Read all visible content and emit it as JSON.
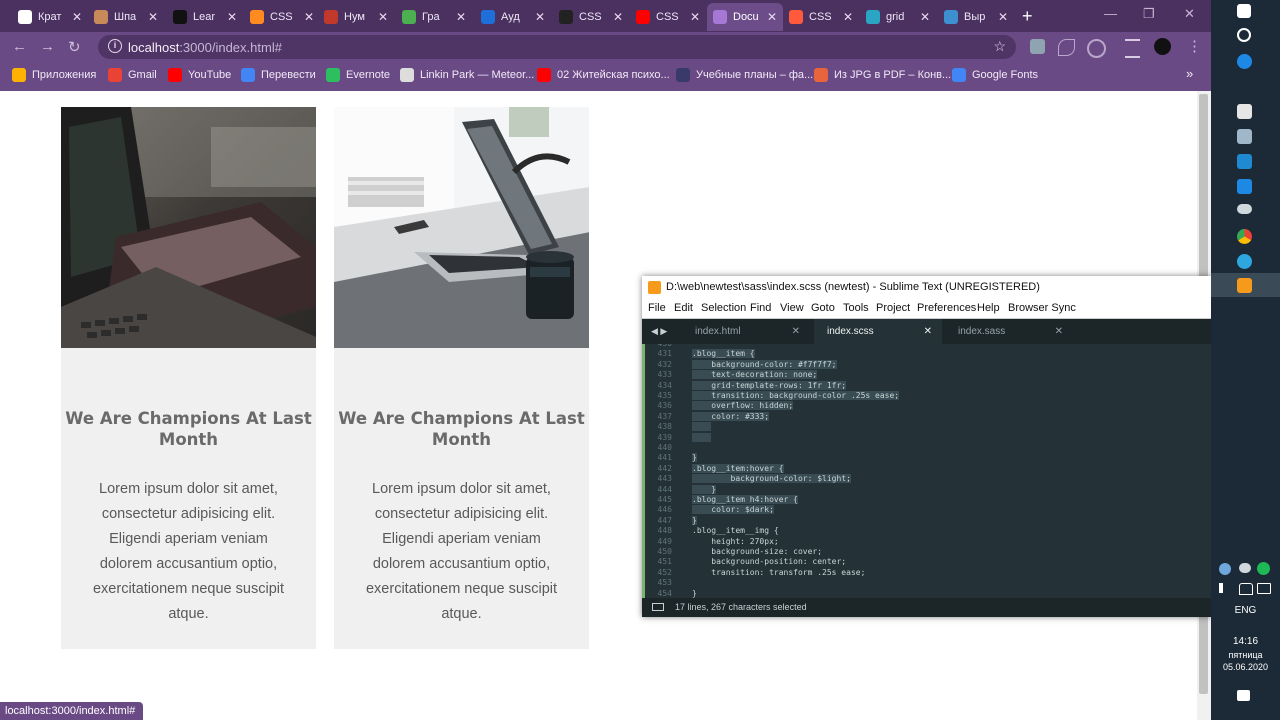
{
  "browser": {
    "tabs": [
      {
        "label": "Крат",
        "favicon_color": "#ffffff"
      },
      {
        "label": "Шпа",
        "favicon_color": "#c98a5a"
      },
      {
        "label": "Lear",
        "favicon_color": "#111111"
      },
      {
        "label": "CSS",
        "favicon_color": "#ff8a1f"
      },
      {
        "label": "Нум",
        "favicon_color": "#c0392b"
      },
      {
        "label": "Гра",
        "favicon_color": "#4caf50"
      },
      {
        "label": "Ауд",
        "favicon_color": "#1e6fd9"
      },
      {
        "label": "CSS",
        "favicon_color": "#222222"
      },
      {
        "label": "CSS",
        "favicon_color": "#ff0000"
      },
      {
        "label": "Docu",
        "favicon_color": "#a678d6",
        "active": true
      },
      {
        "label": "CSS",
        "favicon_color": "#ff5a3c"
      },
      {
        "label": "grid",
        "favicon_color": "#2aa5c4"
      },
      {
        "label": "Выр",
        "favicon_color": "#3d8fd0"
      }
    ],
    "new_tab": "+",
    "window_controls": {
      "minimize": "—",
      "maximize": "❐",
      "close": "✕"
    },
    "nav": {
      "back": "←",
      "forward": "→",
      "reload": "↻"
    },
    "address": {
      "host": "localhost",
      "path": ":3000/index.html#",
      "star": "☆"
    },
    "bookmarks": [
      {
        "label": "Приложения",
        "icon_color": "#ffb300"
      },
      {
        "label": "Gmail",
        "icon_color": "#ea4335"
      },
      {
        "label": "YouTube",
        "icon_color": "#ff0000"
      },
      {
        "label": "Перевести",
        "icon_color": "#4285f4"
      },
      {
        "label": "Evernote",
        "icon_color": "#2dbe60"
      },
      {
        "label": "Linkin Park — Meteor...",
        "icon_color": "#dddddd"
      },
      {
        "label": "02 Житейская психо...",
        "icon_color": "#ff0000"
      },
      {
        "label": "Учебные планы – фа...",
        "icon_color": "#3a3a6a"
      },
      {
        "label": "Из JPG в PDF – Конв...",
        "icon_color": "#e8643c"
      },
      {
        "label": "Google Fonts",
        "icon_color": "#4285f4"
      }
    ],
    "bookmarks_more": "»",
    "status_url": "localhost:3000/index.html#"
  },
  "page": {
    "cards": [
      {
        "title": "We Are Champions At Last Month",
        "text": "Lorem ipsum dolor sit amet, consectetur adipisicing elit. Eligendi aperiam veniam dolorem accusantium optio, exercitationem neque suscipit atque."
      },
      {
        "title": "We Are Champions At Last Month",
        "text": "Lorem ipsum dolor sit amet, consectetur adipisicing elit. Eligendi aperiam veniam dolorem accusantium optio, exercitationem neque suscipit atque."
      }
    ]
  },
  "sublime": {
    "title": "D:\\web\\newtest\\sass\\index.scss (newtest) - Sublime Text (UNREGISTERED)",
    "menu": [
      "File",
      "Edit",
      "Selection",
      "Find",
      "View",
      "Goto",
      "Tools",
      "Project",
      "Preferences",
      "Help",
      "Browser Sync"
    ],
    "tabs": [
      {
        "label": "index.html",
        "active": false
      },
      {
        "label": "index.scss",
        "active": true
      },
      {
        "label": "index.sass",
        "active": false
      }
    ],
    "tab_close": "✕",
    "tab_arrows": "◀ ▶",
    "lines": [
      {
        "n": "430",
        "code": ""
      },
      {
        "n": "431",
        "code": ".blog__item {"
      },
      {
        "n": "432",
        "code": "    background-color: #f7f7f7;"
      },
      {
        "n": "433",
        "code": "    text-decoration: none;"
      },
      {
        "n": "434",
        "code": "    grid-template-rows: 1fr 1fr;"
      },
      {
        "n": "435",
        "code": "    transition: background-color .25s ease;"
      },
      {
        "n": "436",
        "code": "    overflow: hidden;"
      },
      {
        "n": "437",
        "code": "    color: #333;"
      },
      {
        "n": "438",
        "code": "    "
      },
      {
        "n": "439",
        "code": "    "
      },
      {
        "n": "440",
        "code": ""
      },
      {
        "n": "441",
        "code": "}"
      },
      {
        "n": "442",
        "code": ".blog__item:hover {"
      },
      {
        "n": "443",
        "code": "        background-color: $light;"
      },
      {
        "n": "444",
        "code": "    }"
      },
      {
        "n": "445",
        "code": ".blog__item h4:hover {"
      },
      {
        "n": "446",
        "code": "    color: $dark;"
      },
      {
        "n": "447",
        "code": "}"
      },
      {
        "n": "448",
        "code": ".blog__item__img {"
      },
      {
        "n": "449",
        "code": "    height: 270px;"
      },
      {
        "n": "450",
        "code": "    background-size: cover;"
      },
      {
        "n": "451",
        "code": "    background-position: center;"
      },
      {
        "n": "452",
        "code": "    transition: transform .25s ease;"
      },
      {
        "n": "453",
        "code": ""
      },
      {
        "n": "454",
        "code": "}"
      }
    ],
    "status": "17 lines, 267 characters selected"
  },
  "taskbar": {
    "lang": "ENG",
    "time": "14:16",
    "day": "пятница",
    "date": "05.06.2020",
    "icons": [
      "windows-icon",
      "search-icon",
      "edge-icon",
      "store-icon",
      "photos-icon",
      "vscode-icon",
      "mail-icon",
      "glasses-icon",
      "chrome-icon",
      "telegram-icon",
      "sublime-icon"
    ]
  }
}
